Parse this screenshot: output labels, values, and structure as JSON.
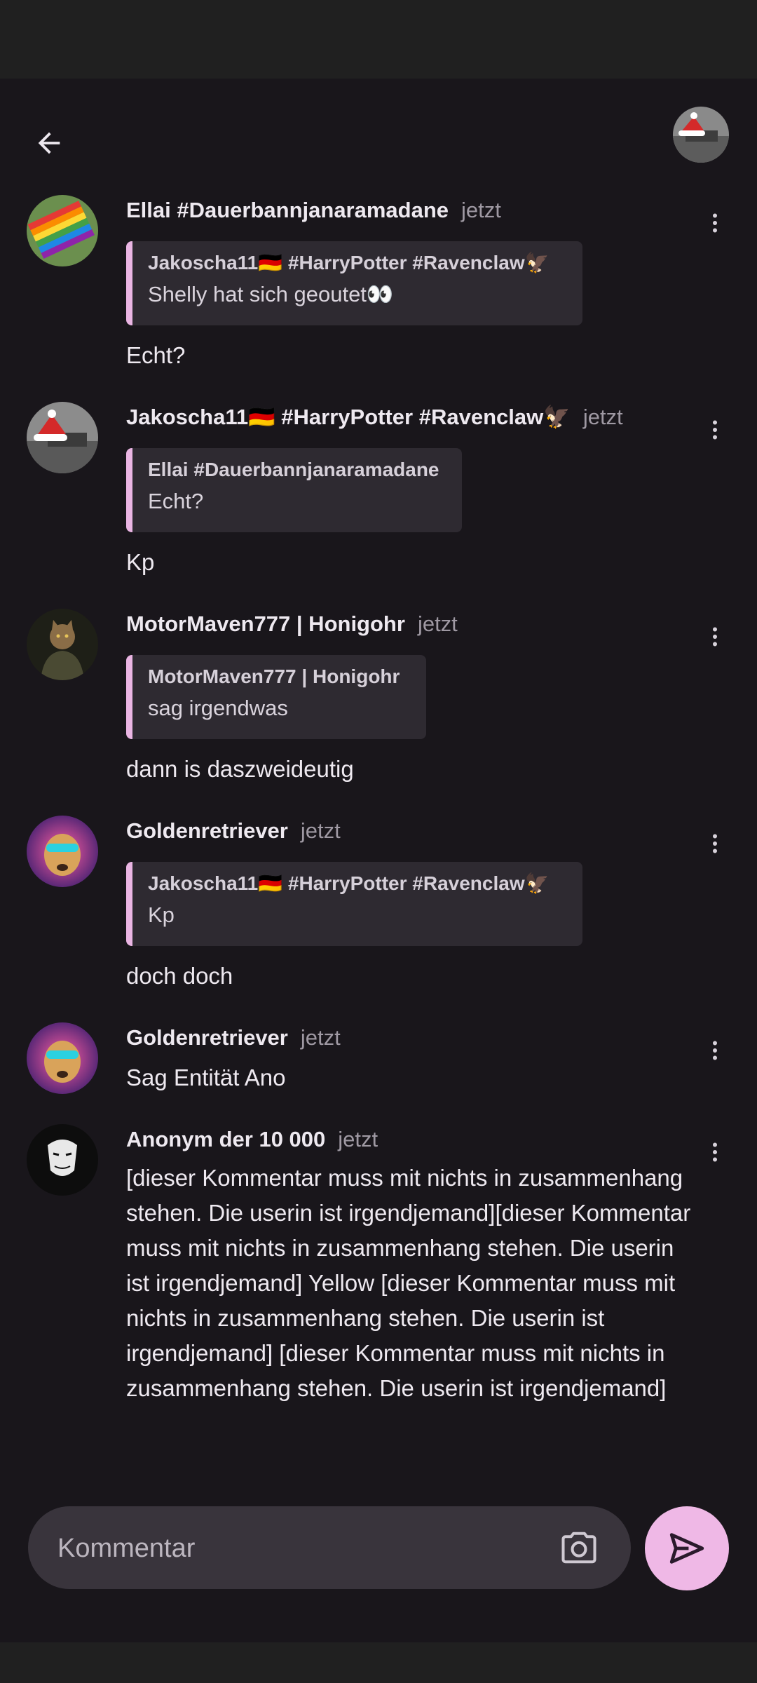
{
  "colors": {
    "background": "#19161b",
    "accent": "#efb8e6",
    "quote_border": "#eab5e3",
    "quote_bg": "#2e2a31",
    "input_bg": "#39343c"
  },
  "header": {
    "back_icon": "arrow-left-icon",
    "avatar": "user-avatar-santa-hat"
  },
  "comments": [
    {
      "author": "Ellai #Dauerbannjanaramadane",
      "time": "jetzt",
      "avatar": "rainbow-flag-avatar",
      "quote": {
        "author": "Jakoscha11🇩🇪 #HarryPotter #Ravenclaw🦅",
        "text": "Shelly hat sich geoutet👀"
      },
      "text": "Echt?"
    },
    {
      "author": "Jakoscha11🇩🇪 #HarryPotter #Ravenclaw🦅",
      "time": "jetzt",
      "avatar": "santa-hat-avatar",
      "quote": {
        "author": "Ellai #Dauerbannjanaramadane",
        "text": "Echt?"
      },
      "text": "Kp"
    },
    {
      "author": "MotorMaven777 | Honigohr",
      "time": "jetzt",
      "avatar": "cat-soldier-avatar",
      "quote": {
        "author": "MotorMaven777 | Honigohr",
        "text": "sag irgendwas"
      },
      "text": "dann is daszweideutig"
    },
    {
      "author": "Goldenretriever",
      "time": "jetzt",
      "avatar": "dog-sunglasses-avatar",
      "quote": {
        "author": "Jakoscha11🇩🇪 #HarryPotter #Ravenclaw🦅",
        "text": "Kp"
      },
      "text": "doch doch"
    },
    {
      "author": "Goldenretriever",
      "time": "jetzt",
      "avatar": "dog-sunglasses-avatar",
      "text": "Sag Entität Ano"
    },
    {
      "author": "Anonym der 10 000",
      "time": "jetzt",
      "avatar": "anonymous-mask-avatar",
      "text": "[dieser Kommentar muss mit nichts in zusammenhang stehen. Die userin ist irgendjemand][dieser Kommentar muss mit nichts in zusammenhang stehen. Die userin ist irgendjemand] Yellow [dieser Kommentar muss mit nichts in zusammenhang stehen. Die userin ist irgendjemand] [dieser Kommentar muss mit nichts in zusammenhang stehen. Die userin ist irgendjemand]"
    }
  ],
  "composer": {
    "placeholder": "Kommentar",
    "camera_icon": "camera-icon",
    "send_icon": "send-icon"
  }
}
